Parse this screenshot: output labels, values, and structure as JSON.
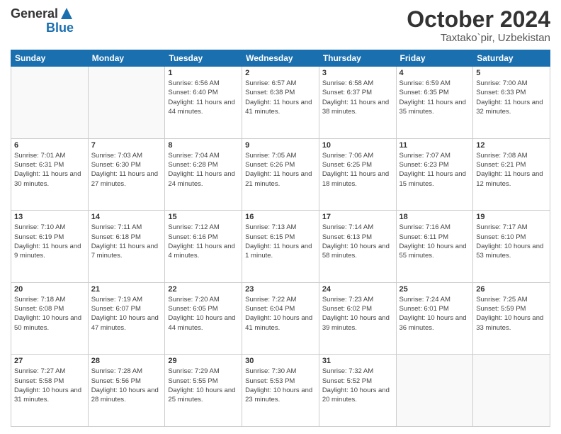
{
  "header": {
    "logo": {
      "line1": "General",
      "line2": "Blue"
    },
    "title": "October 2024",
    "subtitle": "Taxtako`pir, Uzbekistan"
  },
  "calendar": {
    "days_of_week": [
      "Sunday",
      "Monday",
      "Tuesday",
      "Wednesday",
      "Thursday",
      "Friday",
      "Saturday"
    ],
    "weeks": [
      [
        {
          "day": "",
          "empty": true
        },
        {
          "day": "",
          "empty": true
        },
        {
          "day": "1",
          "sunrise": "Sunrise: 6:56 AM",
          "sunset": "Sunset: 6:40 PM",
          "daylight": "Daylight: 11 hours and 44 minutes."
        },
        {
          "day": "2",
          "sunrise": "Sunrise: 6:57 AM",
          "sunset": "Sunset: 6:38 PM",
          "daylight": "Daylight: 11 hours and 41 minutes."
        },
        {
          "day": "3",
          "sunrise": "Sunrise: 6:58 AM",
          "sunset": "Sunset: 6:37 PM",
          "daylight": "Daylight: 11 hours and 38 minutes."
        },
        {
          "day": "4",
          "sunrise": "Sunrise: 6:59 AM",
          "sunset": "Sunset: 6:35 PM",
          "daylight": "Daylight: 11 hours and 35 minutes."
        },
        {
          "day": "5",
          "sunrise": "Sunrise: 7:00 AM",
          "sunset": "Sunset: 6:33 PM",
          "daylight": "Daylight: 11 hours and 32 minutes."
        }
      ],
      [
        {
          "day": "6",
          "sunrise": "Sunrise: 7:01 AM",
          "sunset": "Sunset: 6:31 PM",
          "daylight": "Daylight: 11 hours and 30 minutes."
        },
        {
          "day": "7",
          "sunrise": "Sunrise: 7:03 AM",
          "sunset": "Sunset: 6:30 PM",
          "daylight": "Daylight: 11 hours and 27 minutes."
        },
        {
          "day": "8",
          "sunrise": "Sunrise: 7:04 AM",
          "sunset": "Sunset: 6:28 PM",
          "daylight": "Daylight: 11 hours and 24 minutes."
        },
        {
          "day": "9",
          "sunrise": "Sunrise: 7:05 AM",
          "sunset": "Sunset: 6:26 PM",
          "daylight": "Daylight: 11 hours and 21 minutes."
        },
        {
          "day": "10",
          "sunrise": "Sunrise: 7:06 AM",
          "sunset": "Sunset: 6:25 PM",
          "daylight": "Daylight: 11 hours and 18 minutes."
        },
        {
          "day": "11",
          "sunrise": "Sunrise: 7:07 AM",
          "sunset": "Sunset: 6:23 PM",
          "daylight": "Daylight: 11 hours and 15 minutes."
        },
        {
          "day": "12",
          "sunrise": "Sunrise: 7:08 AM",
          "sunset": "Sunset: 6:21 PM",
          "daylight": "Daylight: 11 hours and 12 minutes."
        }
      ],
      [
        {
          "day": "13",
          "sunrise": "Sunrise: 7:10 AM",
          "sunset": "Sunset: 6:19 PM",
          "daylight": "Daylight: 11 hours and 9 minutes."
        },
        {
          "day": "14",
          "sunrise": "Sunrise: 7:11 AM",
          "sunset": "Sunset: 6:18 PM",
          "daylight": "Daylight: 11 hours and 7 minutes."
        },
        {
          "day": "15",
          "sunrise": "Sunrise: 7:12 AM",
          "sunset": "Sunset: 6:16 PM",
          "daylight": "Daylight: 11 hours and 4 minutes."
        },
        {
          "day": "16",
          "sunrise": "Sunrise: 7:13 AM",
          "sunset": "Sunset: 6:15 PM",
          "daylight": "Daylight: 11 hours and 1 minute."
        },
        {
          "day": "17",
          "sunrise": "Sunrise: 7:14 AM",
          "sunset": "Sunset: 6:13 PM",
          "daylight": "Daylight: 10 hours and 58 minutes."
        },
        {
          "day": "18",
          "sunrise": "Sunrise: 7:16 AM",
          "sunset": "Sunset: 6:11 PM",
          "daylight": "Daylight: 10 hours and 55 minutes."
        },
        {
          "day": "19",
          "sunrise": "Sunrise: 7:17 AM",
          "sunset": "Sunset: 6:10 PM",
          "daylight": "Daylight: 10 hours and 53 minutes."
        }
      ],
      [
        {
          "day": "20",
          "sunrise": "Sunrise: 7:18 AM",
          "sunset": "Sunset: 6:08 PM",
          "daylight": "Daylight: 10 hours and 50 minutes."
        },
        {
          "day": "21",
          "sunrise": "Sunrise: 7:19 AM",
          "sunset": "Sunset: 6:07 PM",
          "daylight": "Daylight: 10 hours and 47 minutes."
        },
        {
          "day": "22",
          "sunrise": "Sunrise: 7:20 AM",
          "sunset": "Sunset: 6:05 PM",
          "daylight": "Daylight: 10 hours and 44 minutes."
        },
        {
          "day": "23",
          "sunrise": "Sunrise: 7:22 AM",
          "sunset": "Sunset: 6:04 PM",
          "daylight": "Daylight: 10 hours and 41 minutes."
        },
        {
          "day": "24",
          "sunrise": "Sunrise: 7:23 AM",
          "sunset": "Sunset: 6:02 PM",
          "daylight": "Daylight: 10 hours and 39 minutes."
        },
        {
          "day": "25",
          "sunrise": "Sunrise: 7:24 AM",
          "sunset": "Sunset: 6:01 PM",
          "daylight": "Daylight: 10 hours and 36 minutes."
        },
        {
          "day": "26",
          "sunrise": "Sunrise: 7:25 AM",
          "sunset": "Sunset: 5:59 PM",
          "daylight": "Daylight: 10 hours and 33 minutes."
        }
      ],
      [
        {
          "day": "27",
          "sunrise": "Sunrise: 7:27 AM",
          "sunset": "Sunset: 5:58 PM",
          "daylight": "Daylight: 10 hours and 31 minutes."
        },
        {
          "day": "28",
          "sunrise": "Sunrise: 7:28 AM",
          "sunset": "Sunset: 5:56 PM",
          "daylight": "Daylight: 10 hours and 28 minutes."
        },
        {
          "day": "29",
          "sunrise": "Sunrise: 7:29 AM",
          "sunset": "Sunset: 5:55 PM",
          "daylight": "Daylight: 10 hours and 25 minutes."
        },
        {
          "day": "30",
          "sunrise": "Sunrise: 7:30 AM",
          "sunset": "Sunset: 5:53 PM",
          "daylight": "Daylight: 10 hours and 23 minutes."
        },
        {
          "day": "31",
          "sunrise": "Sunrise: 7:32 AM",
          "sunset": "Sunset: 5:52 PM",
          "daylight": "Daylight: 10 hours and 20 minutes."
        },
        {
          "day": "",
          "empty": true
        },
        {
          "day": "",
          "empty": true
        }
      ]
    ]
  }
}
